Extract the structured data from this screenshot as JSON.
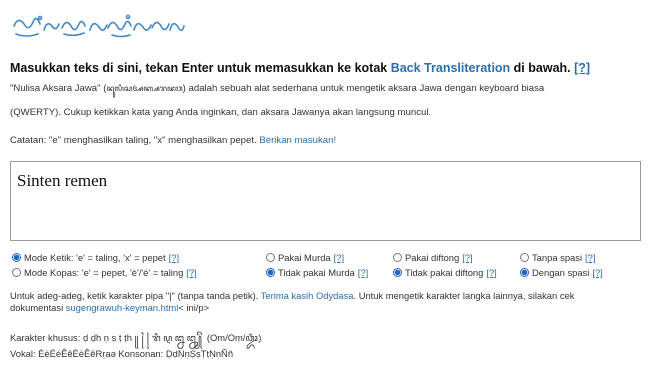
{
  "header": {
    "heading_text": "Masukkan teks di sini, tekan Enter untuk memasukkan ke kotak ",
    "heading_link": "Back Transliteration",
    "heading_suffix": " di bawah.",
    "heading_help": "[?]"
  },
  "intro": {
    "line1_a": "\"Nulisa Aksara Jawa\" (",
    "line1_script": "ꦤꦸꦭꦶꦱꦄꦏ꧀ꦱꦫꦗꦮ",
    "line1_b": ") adalah sebuah alat sederhana untuk mengetik aksara Jawa dengan keyboard biasa",
    "line2": "(QWERTY). Cukup ketikkan kata yang Anda inginkan, dan aksara Jawanya akan langsung muncul.",
    "note": "Catatan: \"e\" menghasilkan taling, \"x\" menghasilkan pepet. ",
    "note_link": "Berikan masukan!"
  },
  "input": {
    "value": "Sinten remen"
  },
  "options": {
    "mode_ketik": "Mode Ketik: 'e' = taling, 'x' = pepet",
    "mode_kopas": "Mode Kopas: 'e' = pepet, 'è'/'é' = taling",
    "pakai_murda": "Pakai Murda",
    "tidak_murda": "Tidak pakai Murda",
    "pakai_diftong": "Pakai diftong",
    "tidak_diftong": "Tidak pakai diftong",
    "tanpa_spasi": "Tanpa spasi",
    "dengan_spasi": "Dengan spasi",
    "help": "[?]"
  },
  "footer": {
    "line1_a": "Untuk adeg-adeg, ketik karakter pipa \"|\" (tanpa tanda petik). ",
    "line1_link": "Terima kasih Odydasa",
    "line1_b": ". Untuk mengetik karakter langka lainnya, silakan cek",
    "line2_a": "dokumentasi ",
    "line2_link": "sugengrawuh-keyman.html",
    "line2_b": "< ini/p>",
    "special_label": "Karakter khusus: ",
    "special_chars": "ḍ ḍh ṇ ṣ ṭ ṭh ꧋ ꧌ ꧍ ꦫꦶ ꦉ ꦊ ꦋ ꧀ ꦼ (Om/Oṃ/ꦎꦴꦀ)",
    "vokal": "Vokal: ÈèÉéÊêÈèÊêRṛaə Konsonan: ḌḍṆṇṢṣṬṭṆṇÑñ"
  },
  "colors": {
    "accent": "#2a6fb0",
    "logo": "#3f86c8",
    "radio": "#1a66c9"
  }
}
